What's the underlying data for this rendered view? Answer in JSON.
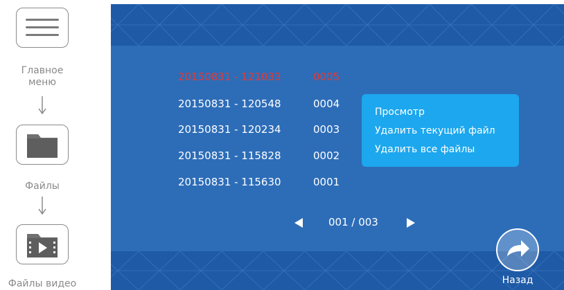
{
  "guide": {
    "main_menu_label_line1": "Главное",
    "main_menu_label_line2": "меню",
    "files_label": "Файлы",
    "video_files_label": "Файлы видео"
  },
  "file_list": [
    {
      "datetime": "20150831 - 121033",
      "number": "0005",
      "selected": true
    },
    {
      "datetime": "20150831 - 120548",
      "number": "0004",
      "selected": false
    },
    {
      "datetime": "20150831 - 120234",
      "number": "0003",
      "selected": false
    },
    {
      "datetime": "20150831 - 115828",
      "number": "0002",
      "selected": false
    },
    {
      "datetime": "20150831 - 115630",
      "number": "0001",
      "selected": false
    }
  ],
  "popup_menu": {
    "view": "Просмотр",
    "delete_current": "Удалить текущий файл",
    "delete_all": "Удалить все файлы"
  },
  "pager": {
    "text": "001 / 003"
  },
  "back": {
    "label": "Назад"
  },
  "colors": {
    "screen_bg": "#2d6db8",
    "band_bg": "#1f5aa6",
    "selected_text": "#e53935",
    "popup_bg": "#1ca7ee",
    "guide_gray": "#8a8a8a"
  }
}
